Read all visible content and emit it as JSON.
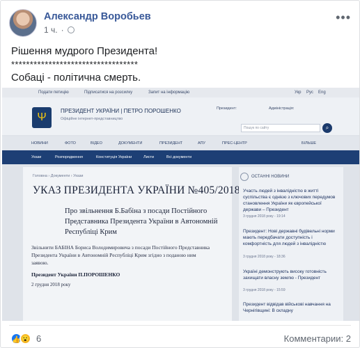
{
  "post": {
    "author": "Александр Воробьев",
    "time": "1 ч.",
    "text_line1": "Рішення мудрого Президента!",
    "text_line2": "**********************************",
    "text_line3": "Собаці - політична смерть."
  },
  "screenshot": {
    "topbar": {
      "item1": "Подати петицію",
      "item2": "Підписатися на розсилку",
      "item3": "Запит на інформацію",
      "langs": [
        "Укр",
        "Рус",
        "Eng"
      ]
    },
    "header": {
      "title": "ПРЕЗИДЕНТ УКРАЇНИ  |  ПЕТРО ПОРОШЕНКО",
      "subtitle": "Офіційне інтернет-представництво",
      "president_label": "Президент:",
      "admin_label": "Адміністрація:",
      "search_placeholder": "Пошук по сайту"
    },
    "nav_main": [
      "НОВИНИ",
      "ФОТО",
      "ВІДЕО",
      "ДОКУМЕНТИ",
      "ПРЕЗИДЕНТ",
      "АПУ",
      "ПРЕС-ЦЕНТР",
      "БІЛЬШЕ"
    ],
    "nav_sub": [
      "Укази",
      "Розпорядження",
      "Конституція України",
      "Листи",
      "Всі документи"
    ],
    "breadcrumb": "Головна  ›  Документи  ›  Укази",
    "decree_title": "УКАЗ ПРЕЗИДЕНТА УКРАЇНИ №405/2018",
    "decree_subtitle": "Про звільнення Б.Бабіна з посади Постійного Представника Президента України в Автономній Республіці Крим",
    "decree_body": "Звільнити БАБІНА Бориса Володимировича з посади Постійного Представника Президента України в Автономній Республіці Крим згідно з поданою ним заявою.",
    "decree_signature": "Президент України П.ПОРОШЕНКО",
    "decree_date": "2 грудня 2018 року",
    "aside_title": "ОСТАННІ НОВИНИ",
    "news": [
      {
        "text": "Участь людей з інвалідністю в житті суспільства є однією з ключових передумов становлення України як європейської держави – Президент",
        "date": "3 грудня 2018 року - 19:14"
      },
      {
        "text": "Президент: Нові державні будівельні норми мають передбачати доступність і комфортність для людей з інвалідністю",
        "date": "3 грудня 2018 року - 18:36"
      },
      {
        "text": "Україні демонструють високу готовність захищати власну землю - Президент",
        "date": "3 грудня 2018 року - 15:59"
      },
      {
        "text": "Президент відвідав військові навчання на Чернігівщині: В складну",
        "date": ""
      }
    ]
  },
  "footer": {
    "reactions_count": "6",
    "comments": "Комментарии: 2"
  }
}
